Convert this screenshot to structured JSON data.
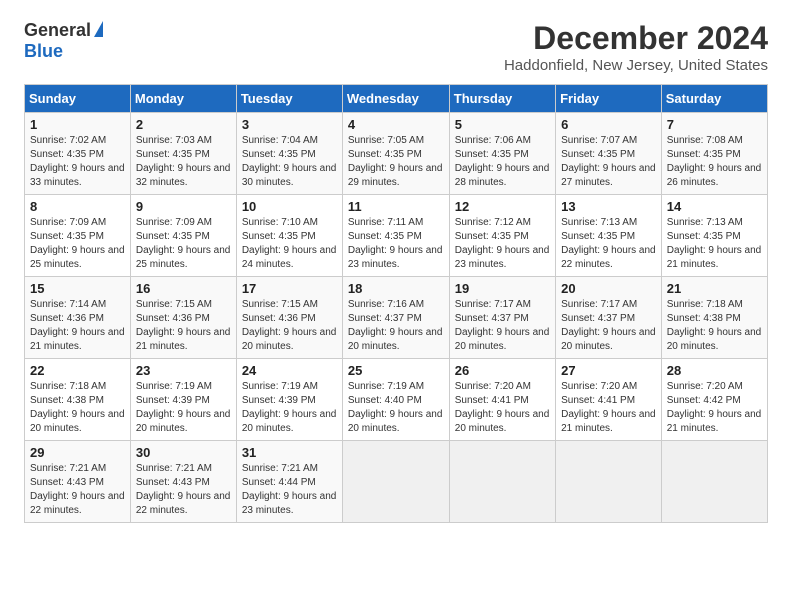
{
  "logo": {
    "general": "General",
    "blue": "Blue"
  },
  "title": "December 2024",
  "location": "Haddonfield, New Jersey, United States",
  "days_of_week": [
    "Sunday",
    "Monday",
    "Tuesday",
    "Wednesday",
    "Thursday",
    "Friday",
    "Saturday"
  ],
  "weeks": [
    [
      {
        "day": "1",
        "sunrise": "7:02 AM",
        "sunset": "4:35 PM",
        "daylight": "9 hours and 33 minutes."
      },
      {
        "day": "2",
        "sunrise": "7:03 AM",
        "sunset": "4:35 PM",
        "daylight": "9 hours and 32 minutes."
      },
      {
        "day": "3",
        "sunrise": "7:04 AM",
        "sunset": "4:35 PM",
        "daylight": "9 hours and 30 minutes."
      },
      {
        "day": "4",
        "sunrise": "7:05 AM",
        "sunset": "4:35 PM",
        "daylight": "9 hours and 29 minutes."
      },
      {
        "day": "5",
        "sunrise": "7:06 AM",
        "sunset": "4:35 PM",
        "daylight": "9 hours and 28 minutes."
      },
      {
        "day": "6",
        "sunrise": "7:07 AM",
        "sunset": "4:35 PM",
        "daylight": "9 hours and 27 minutes."
      },
      {
        "day": "7",
        "sunrise": "7:08 AM",
        "sunset": "4:35 PM",
        "daylight": "9 hours and 26 minutes."
      }
    ],
    [
      {
        "day": "8",
        "sunrise": "7:09 AM",
        "sunset": "4:35 PM",
        "daylight": "9 hours and 25 minutes."
      },
      {
        "day": "9",
        "sunrise": "7:09 AM",
        "sunset": "4:35 PM",
        "daylight": "9 hours and 25 minutes."
      },
      {
        "day": "10",
        "sunrise": "7:10 AM",
        "sunset": "4:35 PM",
        "daylight": "9 hours and 24 minutes."
      },
      {
        "day": "11",
        "sunrise": "7:11 AM",
        "sunset": "4:35 PM",
        "daylight": "9 hours and 23 minutes."
      },
      {
        "day": "12",
        "sunrise": "7:12 AM",
        "sunset": "4:35 PM",
        "daylight": "9 hours and 23 minutes."
      },
      {
        "day": "13",
        "sunrise": "7:13 AM",
        "sunset": "4:35 PM",
        "daylight": "9 hours and 22 minutes."
      },
      {
        "day": "14",
        "sunrise": "7:13 AM",
        "sunset": "4:35 PM",
        "daylight": "9 hours and 21 minutes."
      }
    ],
    [
      {
        "day": "15",
        "sunrise": "7:14 AM",
        "sunset": "4:36 PM",
        "daylight": "9 hours and 21 minutes."
      },
      {
        "day": "16",
        "sunrise": "7:15 AM",
        "sunset": "4:36 PM",
        "daylight": "9 hours and 21 minutes."
      },
      {
        "day": "17",
        "sunrise": "7:15 AM",
        "sunset": "4:36 PM",
        "daylight": "9 hours and 20 minutes."
      },
      {
        "day": "18",
        "sunrise": "7:16 AM",
        "sunset": "4:37 PM",
        "daylight": "9 hours and 20 minutes."
      },
      {
        "day": "19",
        "sunrise": "7:17 AM",
        "sunset": "4:37 PM",
        "daylight": "9 hours and 20 minutes."
      },
      {
        "day": "20",
        "sunrise": "7:17 AM",
        "sunset": "4:37 PM",
        "daylight": "9 hours and 20 minutes."
      },
      {
        "day": "21",
        "sunrise": "7:18 AM",
        "sunset": "4:38 PM",
        "daylight": "9 hours and 20 minutes."
      }
    ],
    [
      {
        "day": "22",
        "sunrise": "7:18 AM",
        "sunset": "4:38 PM",
        "daylight": "9 hours and 20 minutes."
      },
      {
        "day": "23",
        "sunrise": "7:19 AM",
        "sunset": "4:39 PM",
        "daylight": "9 hours and 20 minutes."
      },
      {
        "day": "24",
        "sunrise": "7:19 AM",
        "sunset": "4:39 PM",
        "daylight": "9 hours and 20 minutes."
      },
      {
        "day": "25",
        "sunrise": "7:19 AM",
        "sunset": "4:40 PM",
        "daylight": "9 hours and 20 minutes."
      },
      {
        "day": "26",
        "sunrise": "7:20 AM",
        "sunset": "4:41 PM",
        "daylight": "9 hours and 20 minutes."
      },
      {
        "day": "27",
        "sunrise": "7:20 AM",
        "sunset": "4:41 PM",
        "daylight": "9 hours and 21 minutes."
      },
      {
        "day": "28",
        "sunrise": "7:20 AM",
        "sunset": "4:42 PM",
        "daylight": "9 hours and 21 minutes."
      }
    ],
    [
      {
        "day": "29",
        "sunrise": "7:21 AM",
        "sunset": "4:43 PM",
        "daylight": "9 hours and 22 minutes."
      },
      {
        "day": "30",
        "sunrise": "7:21 AM",
        "sunset": "4:43 PM",
        "daylight": "9 hours and 22 minutes."
      },
      {
        "day": "31",
        "sunrise": "7:21 AM",
        "sunset": "4:44 PM",
        "daylight": "9 hours and 23 minutes."
      },
      null,
      null,
      null,
      null
    ]
  ],
  "labels": {
    "sunrise": "Sunrise:",
    "sunset": "Sunset:",
    "daylight": "Daylight:"
  }
}
